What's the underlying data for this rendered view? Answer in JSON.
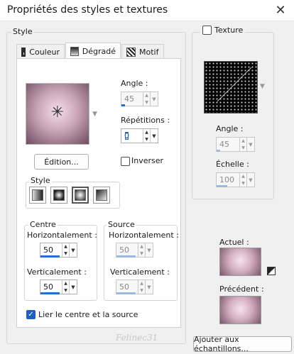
{
  "window": {
    "title": "Propriétés des styles et textures",
    "close_glyph": "✕"
  },
  "style_group": {
    "label": "Style",
    "tabs": [
      {
        "label": "Couleur",
        "icon": "solid-color-icon",
        "active": false
      },
      {
        "label": "Dégradé",
        "icon": "gradient-icon",
        "active": true
      },
      {
        "label": "Motif",
        "icon": "pattern-icon",
        "active": false
      }
    ],
    "angle_label": "Angle :",
    "angle_value": "45",
    "repetitions_label": "Répétitions :",
    "repetitions_value": "0",
    "edit_button": "Édition...",
    "invert_label": "Inverser",
    "invert_checked": false,
    "gradient_style_label": "Style",
    "gradient_styles": [
      "linear",
      "rectangular",
      "radial-active",
      "corner"
    ],
    "center_label": "Centre",
    "center_h_label": "Horizontalement :",
    "center_h_value": "50",
    "center_v_label": "Verticalement :",
    "center_v_value": "50",
    "source_label": "Source",
    "source_h_label": "Horizontalement :",
    "source_h_value": "50",
    "source_v_label": "Verticalement :",
    "source_v_value": "50",
    "link_label": "Lier le centre et la source",
    "link_checked": true
  },
  "texture_group": {
    "label": "Texture",
    "checked": false,
    "angle_label": "Angle :",
    "angle_value": "45",
    "scale_label": "Échelle :",
    "scale_value": "100"
  },
  "samples": {
    "current_label": "Actuel :",
    "previous_label": "Précédent :",
    "add_button": "Ajouter aux échantillons...",
    "watermark": "Felinec31"
  },
  "colors": {
    "accent": "#1f6fd6",
    "gradient_light": "#f6dfe8",
    "gradient_mid": "#c9a4b6",
    "gradient_dark": "#6e4b5f"
  }
}
